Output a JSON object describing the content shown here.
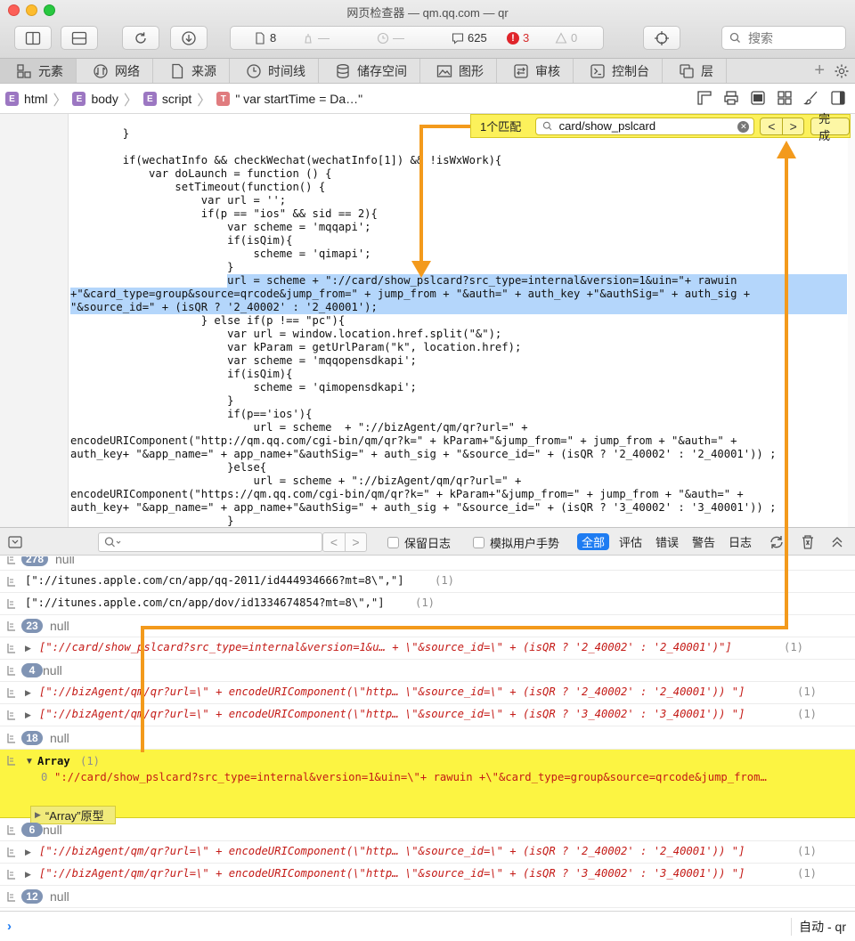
{
  "window": {
    "title": "网页检查器 — qm.qq.com — qr"
  },
  "toolbar": {
    "stats": {
      "resources": "8",
      "requests": "—",
      "time": "—",
      "logs": "625",
      "errors": "3",
      "warnings": "0"
    },
    "search_placeholder": "搜索"
  },
  "tabs": [
    {
      "label": "元素",
      "icon": "elements-icon"
    },
    {
      "label": "网络",
      "icon": "network-icon"
    },
    {
      "label": "来源",
      "icon": "sources-icon"
    },
    {
      "label": "时间线",
      "icon": "timeline-icon"
    },
    {
      "label": "储存空间",
      "icon": "storage-icon"
    },
    {
      "label": "图形",
      "icon": "graphics-icon"
    },
    {
      "label": "审核",
      "icon": "audit-icon"
    },
    {
      "label": "控制台",
      "icon": "console-icon"
    },
    {
      "label": "层",
      "icon": "layers-icon"
    }
  ],
  "breadcrumb": [
    {
      "type": "E",
      "label": "html"
    },
    {
      "type": "E",
      "label": "body"
    },
    {
      "type": "E",
      "label": "script"
    },
    {
      "type": "T",
      "label": "\" var startTime = Da…\""
    }
  ],
  "find": {
    "match_count": "1个匹配",
    "query": "card/show_pslcard",
    "done_label": "完成"
  },
  "code_lines": [
    "        }",
    "",
    "        if(wechatInfo && checkWechat(wechatInfo[1]) && !isWxWork){",
    "            var doLaunch = function () {",
    "                setTimeout(function() {",
    "                    var url = '';",
    "                    if(p == \"ios\" && sid == 2){",
    "                        var scheme = 'mqqapi';",
    "                        if(isQim){",
    "                            scheme = 'qimapi';",
    "                        }",
    "                        url = scheme + \"://card/show_pslcard?src_type=internal&version=1&uin=\"+ rawuin",
    "+\"&card_type=group&source=qrcode&jump_from=\" + jump_from + \"&auth=\" + auth_key +\"&authSig=\" + auth_sig +",
    "\"&source_id=\" + (isQR ? '2_40002' : '2_40001');",
    "                    } else if(p !== \"pc\"){",
    "                        var url = window.location.href.split(\"&\");",
    "                        var kParam = getUrlParam(\"k\", location.href);",
    "                        var scheme = 'mqqopensdkapi';",
    "                        if(isQim){",
    "                            scheme = 'qimopensdkapi';",
    "                        }",
    "                        if(p=='ios'){",
    "                            url = scheme  + \"://bizAgent/qm/qr?url=\" +",
    "encodeURIComponent(\"http://qm.qq.com/cgi-bin/qm/qr?k=\" + kParam+\"&jump_from=\" + jump_from + \"&auth=\" +",
    "auth_key+ \"&app_name=\" + app_name+\"&authSig=\" + auth_sig + \"&source_id=\" + (isQR ? '2_40002' : '2_40001')) ;",
    "                        }else{",
    "                            url = scheme + \"://bizAgent/qm/qr?url=\" +",
    "encodeURIComponent(\"https://qm.qq.com/cgi-bin/qm/qr?k=\" + kParam+\"&jump_from=\" + jump_from + \"&auth=\" +",
    "auth_key+ \"&app_name=\" + app_name+\"&authSig=\" + auth_sig + \"&source_id=\" + (isQR ? '3_40002' : '3_40001')) ;",
    "                        }"
  ],
  "console_toolbar": {
    "preserve_log": "保留日志",
    "emulate_gesture": "模拟用户手势",
    "filters": [
      "全部",
      "评估",
      "错误",
      "警告",
      "日志"
    ]
  },
  "console_messages": {
    "m0_badge": "278",
    "m0_text": "null",
    "m1_text": "[\"://itunes.apple.com/cn/app/qq-2011/id444934666?mt=8\\\",\"]",
    "m1_count": "(1)",
    "m2_text": "[\"://itunes.apple.com/cn/app/dov/id1334674854?mt=8\\\",\"]",
    "m2_count": "(1)",
    "m3_badge": "23",
    "m3_text": "null",
    "m4_text": "[\"://card/show_pslcard?src_type=internal&version=1&u… + \\\"&source_id=\\\" + (isQR ? '2_40002' : '2_40001')\"]",
    "m4_count": "(1)",
    "m5_badge": "4",
    "m5_text": "null",
    "m6_text": "[\"://bizAgent/qm/qr?url=\\\" + encodeURIComponent(\\\"http… \\\"&source_id=\\\" + (isQR ? '2_40002' : '2_40001')) \"]",
    "m6_count": "(1)",
    "m7_text": "[\"://bizAgent/qm/qr?url=\\\" + encodeURIComponent(\\\"http… \\\"&source_id=\\\" + (isQR ? '3_40002' : '3_40001')) \"]",
    "m7_count": "(1)",
    "m8_badge": "18",
    "m8_text": "null",
    "m9_label": "Array",
    "m9_count": "(1)",
    "m9_index": "0",
    "m9_value": "\"://card/show_pslcard?src_type=internal&version=1&uin=\\\"+ rawuin +\\\"&card_type=group&source=qrcode&jump_from…",
    "m9_proto": "“Array”原型",
    "m10_badge": "6",
    "m10_text": "null",
    "m11_text": "[\"://bizAgent/qm/qr?url=\\\" + encodeURIComponent(\\\"http… \\\"&source_id=\\\" + (isQR ? '2_40002' : '2_40001')) \"]",
    "m11_count": "(1)",
    "m12_text": "[\"://bizAgent/qm/qr?url=\\\" + encodeURIComponent(\\\"http… \\\"&source_id=\\\" + (isQR ? '3_40002' : '3_40001')) \"]",
    "m12_count": "(1)",
    "m13_badge": "12",
    "m13_text": "null"
  },
  "console_input": {
    "context": "自动 - qr"
  },
  "colors": {
    "annotation": "#f39a1c",
    "find_highlight": "#fcf442",
    "code_selection": "#b4d6fb",
    "filter_active": "#1e7cf2"
  }
}
